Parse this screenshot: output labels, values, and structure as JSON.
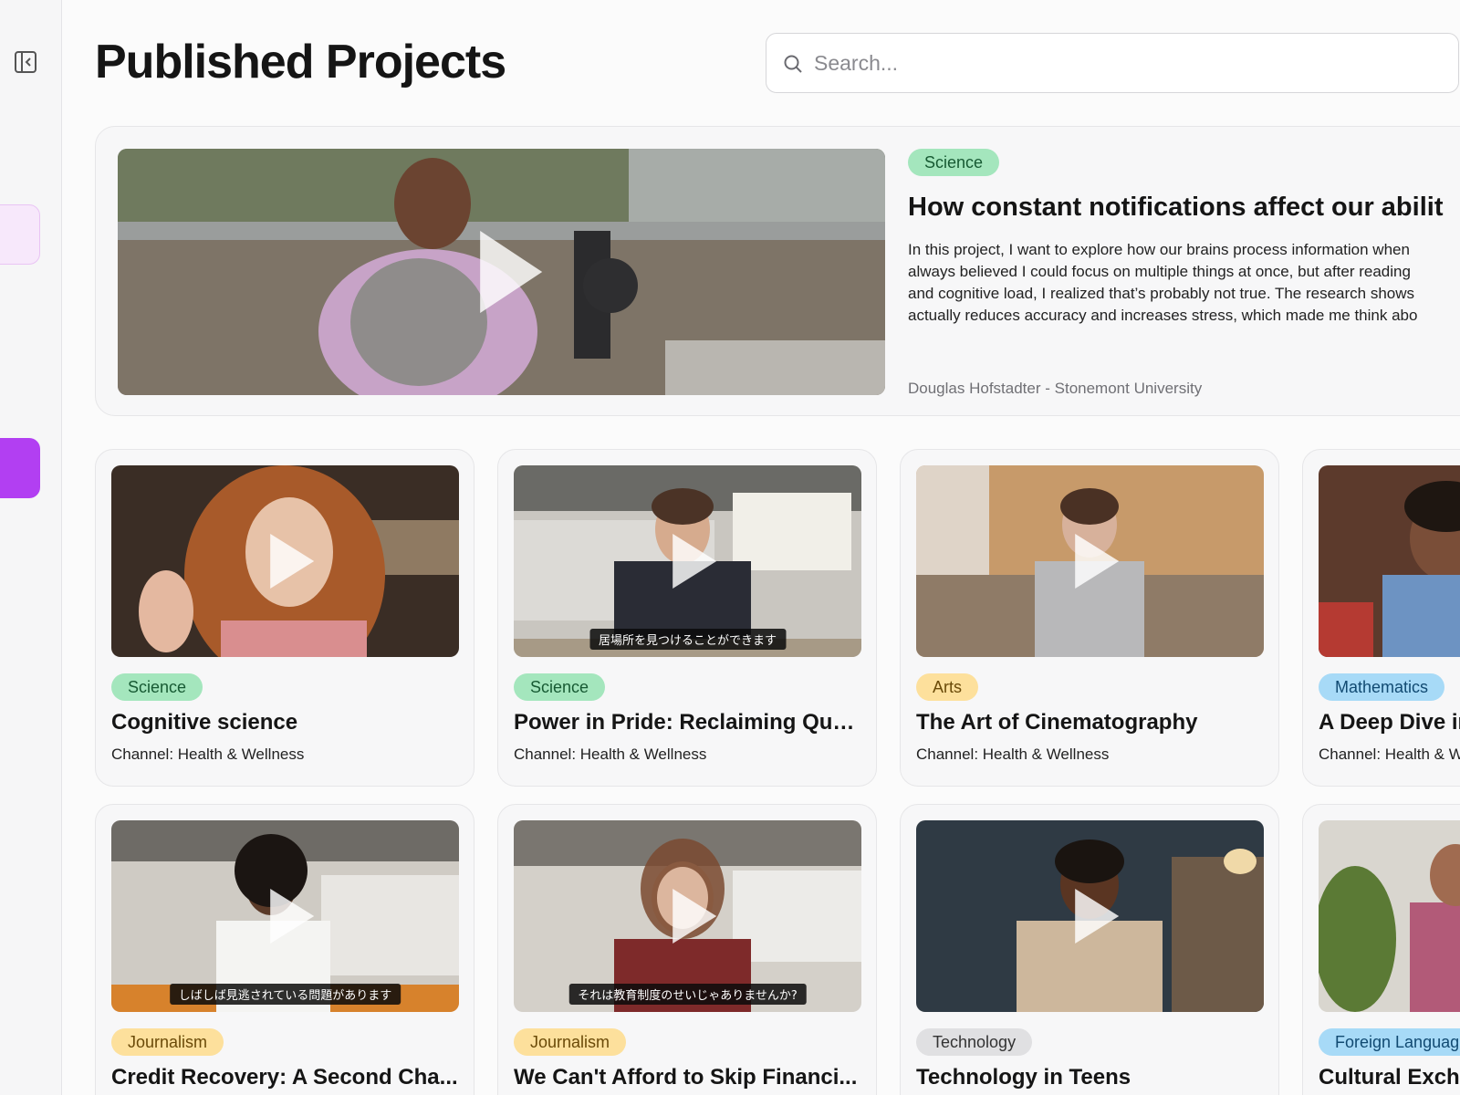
{
  "page": {
    "title": "Published Projects"
  },
  "search": {
    "placeholder": "Search..."
  },
  "featured": {
    "category": "Science",
    "title": "How constant notifications affect our abilit",
    "description": "In this project, I want to explore how our brains process information when \nalways believed I could focus on multiple things at once, but after reading \nand cognitive load, I realized that’s probably not true. The research shows \nactually reduces accuracy and increases stress, which made me think abo",
    "author": "Douglas Hofstadter - Stonemont University"
  },
  "cards": [
    {
      "category": "Science",
      "title": "Cognitive science",
      "channel": "Channel: Health & Wellness"
    },
    {
      "category": "Science",
      "title": "Power in Pride: Reclaiming Que...",
      "channel": "Channel: Health & Wellness",
      "subtitle": "居場所を見つけることができます"
    },
    {
      "category": "Arts",
      "title": "The Art of Cinematography",
      "channel": "Channel: Health & Wellness"
    },
    {
      "category": "Mathematics",
      "title": "A Deep Dive in",
      "channel": "Channel: Health & W"
    },
    {
      "category": "Journalism",
      "title": "Credit Recovery: A Second Cha...",
      "channel": "",
      "subtitle": "しばしば見逃されている問題があります"
    },
    {
      "category": "Journalism",
      "title": "We Can't Afford to Skip Financi...",
      "channel": "",
      "subtitle": "それは教育制度のせいじゃありませんか?"
    },
    {
      "category": "Technology",
      "title": "Technology in Teens",
      "channel": ""
    },
    {
      "category": "Foreign Languag",
      "title": "Cultural Excha",
      "channel": ""
    }
  ],
  "colors": {
    "accent": "#b23ff2",
    "accent_light": "#f7e8fb"
  }
}
